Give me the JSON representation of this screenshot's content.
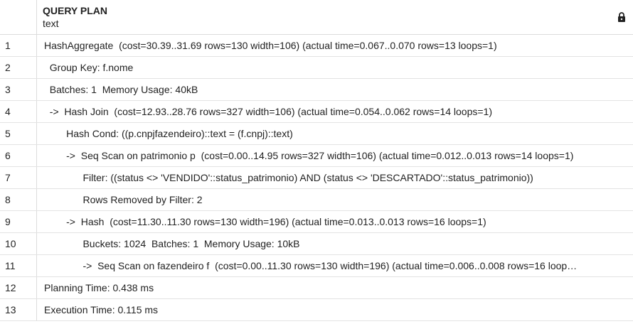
{
  "column": {
    "name": "QUERY PLAN",
    "type": "text",
    "lock_icon": "lock-icon"
  },
  "rows": [
    {
      "num": "1",
      "text": "HashAggregate  (cost=30.39..31.69 rows=130 width=106) (actual time=0.067..0.070 rows=13 loops=1)"
    },
    {
      "num": "2",
      "text": "  Group Key: f.nome"
    },
    {
      "num": "3",
      "text": "  Batches: 1  Memory Usage: 40kB"
    },
    {
      "num": "4",
      "text": "  ->  Hash Join  (cost=12.93..28.76 rows=327 width=106) (actual time=0.054..0.062 rows=14 loops=1)"
    },
    {
      "num": "5",
      "text": "        Hash Cond: ((p.cnpjfazendeiro)::text = (f.cnpj)::text)"
    },
    {
      "num": "6",
      "text": "        ->  Seq Scan on patrimonio p  (cost=0.00..14.95 rows=327 width=106) (actual time=0.012..0.013 rows=14 loops=1)"
    },
    {
      "num": "7",
      "text": "              Filter: ((status <> 'VENDIDO'::status_patrimonio) AND (status <> 'DESCARTADO'::status_patrimonio))"
    },
    {
      "num": "8",
      "text": "              Rows Removed by Filter: 2"
    },
    {
      "num": "9",
      "text": "        ->  Hash  (cost=11.30..11.30 rows=130 width=196) (actual time=0.013..0.013 rows=16 loops=1)"
    },
    {
      "num": "10",
      "text": "              Buckets: 1024  Batches: 1  Memory Usage: 10kB"
    },
    {
      "num": "11",
      "text": "              ->  Seq Scan on fazendeiro f  (cost=0.00..11.30 rows=130 width=196) (actual time=0.006..0.008 rows=16 loop…"
    },
    {
      "num": "12",
      "text": "Planning Time: 0.438 ms"
    },
    {
      "num": "13",
      "text": "Execution Time: 0.115 ms"
    }
  ]
}
